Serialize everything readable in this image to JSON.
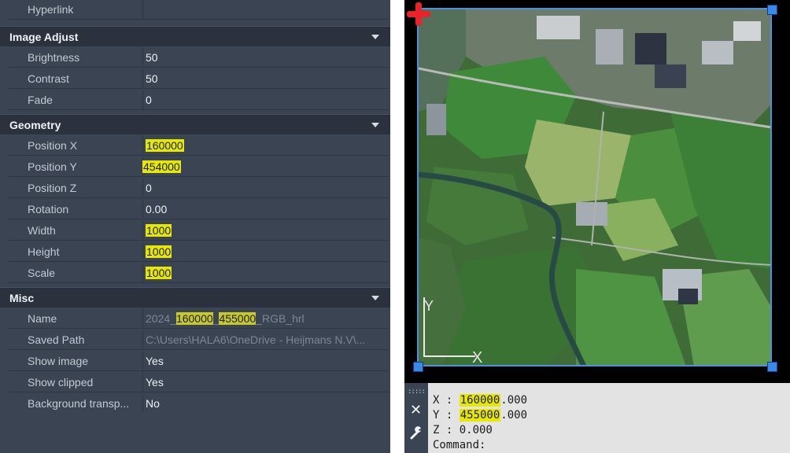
{
  "properties": {
    "partial_row": {
      "label": "Hyperlink",
      "value": ""
    },
    "sections": [
      {
        "title": "Image Adjust",
        "rows": [
          {
            "label": "Brightness",
            "value": "50"
          },
          {
            "label": "Contrast",
            "value": "50"
          },
          {
            "label": "Fade",
            "value": "0"
          }
        ]
      },
      {
        "title": "Geometry",
        "rows": [
          {
            "label": "Position X",
            "value": "160000"
          },
          {
            "label": "Position Y",
            "value": "454000"
          },
          {
            "label": "Position Z",
            "value": "0"
          },
          {
            "label": "Rotation",
            "value": "0.00"
          },
          {
            "label": "Width",
            "value": "1000"
          },
          {
            "label": "Height",
            "value": "1000"
          },
          {
            "label": "Scale",
            "value": "1000"
          }
        ]
      },
      {
        "title": "Misc",
        "rows": [
          {
            "label": "Name",
            "value_parts": [
              "2024_",
              "160000",
              "_",
              "455000",
              "_RGB_hrl"
            ]
          },
          {
            "label": "Saved Path",
            "value": "C:\\Users\\HALA6\\OneDrive - Heijmans N.V\\..."
          },
          {
            "label": "Show image",
            "value": "Yes"
          },
          {
            "label": "Show clipped",
            "value": "Yes"
          },
          {
            "label": "Background transp...",
            "value": "No"
          }
        ]
      }
    ]
  },
  "viewport": {
    "ucs_y_label": "Y",
    "ucs_x_label": "X"
  },
  "command_line": {
    "grip_icon": "grip-dots",
    "close_icon": "close-x",
    "settings_icon": "wrench",
    "coord_x_label": "X : ",
    "coord_x_int": "160000",
    "coord_x_dec": ".000",
    "coord_y_label": "Y : ",
    "coord_y_int": "455000",
    "coord_y_dec": ".000",
    "coord_z": "Z : 0.000",
    "prompt": "Command:"
  },
  "colors": {
    "panel_bg": "#3b4453",
    "category_bg": "#2b323e",
    "highlight": "#e6e800",
    "selection_frame": "#4f8fe0",
    "grip": "#3a88e8",
    "origin_marker": "#e8242a"
  }
}
